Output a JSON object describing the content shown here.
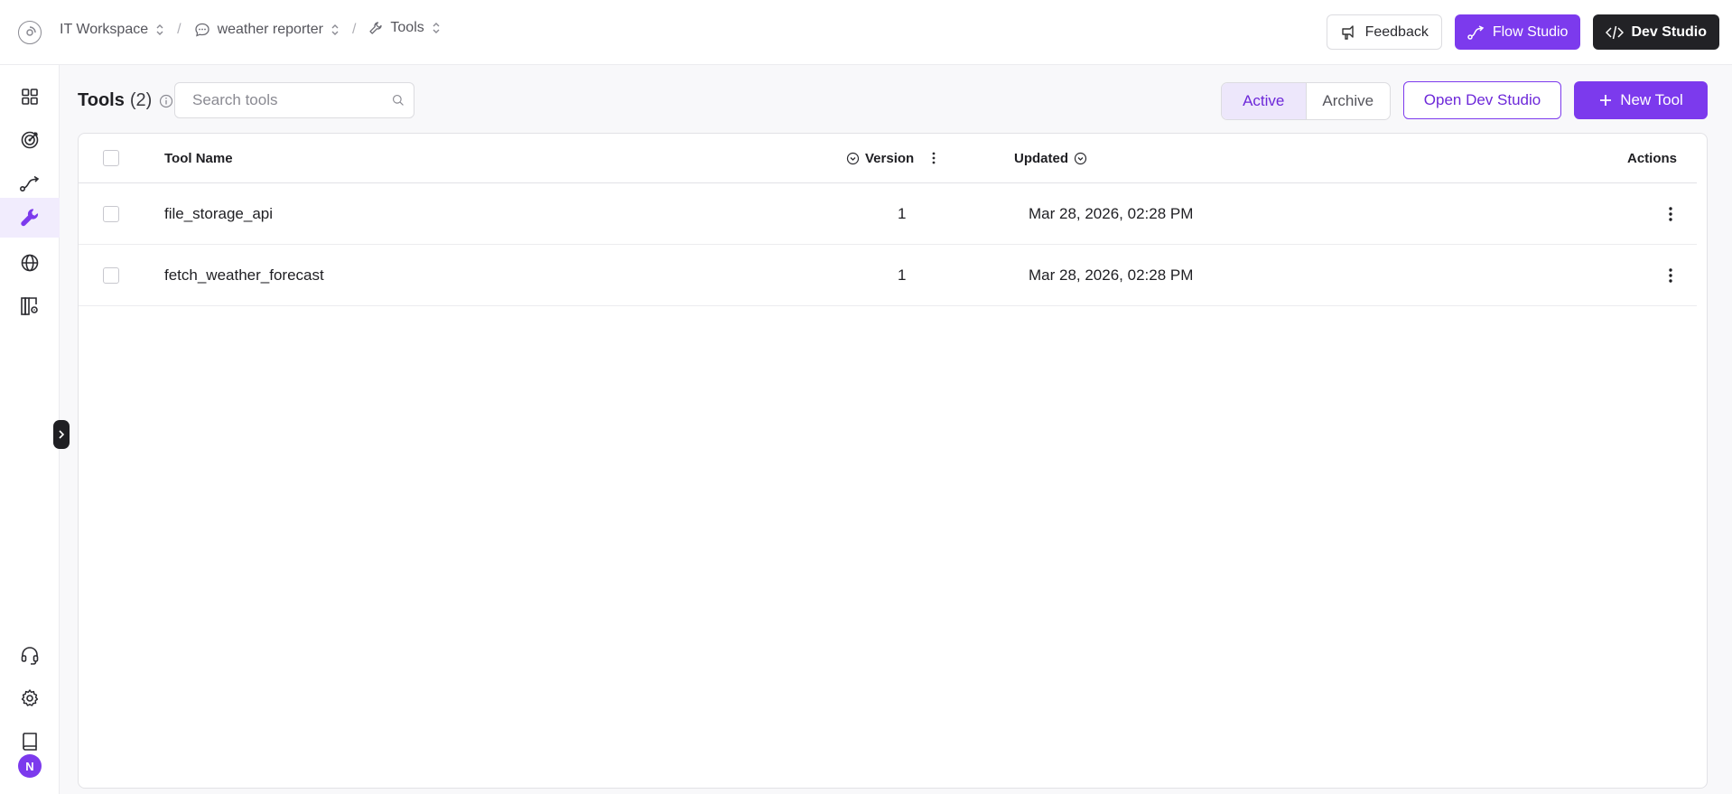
{
  "breadcrumb": {
    "workspace": "IT Workspace",
    "agent": "weather reporter",
    "page": "Tools"
  },
  "top_actions": {
    "feedback": "Feedback",
    "flow_studio": "Flow Studio",
    "dev_studio": "Dev Studio"
  },
  "sidebar": {
    "items": [
      {
        "icon": "dashboard-icon"
      },
      {
        "icon": "target-icon"
      },
      {
        "icon": "flow-icon"
      },
      {
        "icon": "wrench-icon",
        "active": true
      },
      {
        "icon": "globe-icon"
      },
      {
        "icon": "library-settings-icon"
      }
    ],
    "bottom": [
      {
        "icon": "headset-icon"
      },
      {
        "icon": "gear-icon"
      },
      {
        "icon": "book-icon"
      }
    ],
    "avatar_initial": "N"
  },
  "main": {
    "title": "Tools",
    "count": "(2)",
    "search_placeholder": "Search tools",
    "tabs": {
      "active": "Active",
      "archive": "Archive"
    },
    "open_dev_studio": "Open Dev Studio",
    "new_tool": "New Tool"
  },
  "table": {
    "headers": {
      "name": "Tool Name",
      "version": "Version",
      "updated": "Updated",
      "actions": "Actions"
    },
    "rows": [
      {
        "name": "file_storage_api",
        "version": "1",
        "updated": "Mar 28, 2026, 02:28 PM"
      },
      {
        "name": "fetch_weather_forecast",
        "version": "1",
        "updated": "Mar 28, 2026, 02:28 PM"
      }
    ]
  },
  "colors": {
    "accent": "#7c3aed",
    "dark": "#222226"
  }
}
